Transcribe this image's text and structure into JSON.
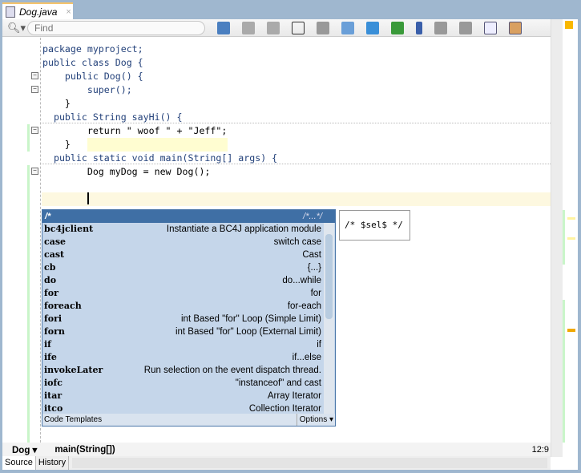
{
  "tab": {
    "title": "Dog.java",
    "close": "×"
  },
  "toolbar": {
    "find_placeholder": "Find"
  },
  "code": [
    "package myproject;",
    "",
    "public class Dog {",
    "    public Dog() {",
    "        super();",
    "    }",
    "  public String sayHi() {",
    "        return \" woof \" + \"Jeff\";",
    "    }",
    "  public static void main(String[] args) {",
    "        Dog myDog = new Dog();",
    ""
  ],
  "popup": {
    "header_left": "/*",
    "header_right": "/*...*/",
    "items": [
      {
        "abbr": "bc4jclient",
        "desc": "Instantiate a BC4J application module"
      },
      {
        "abbr": "case",
        "desc": "switch case"
      },
      {
        "abbr": "cast",
        "desc": "Cast"
      },
      {
        "abbr": "cb",
        "desc": "{...}"
      },
      {
        "abbr": "do",
        "desc": "do...while"
      },
      {
        "abbr": "for",
        "desc": "for"
      },
      {
        "abbr": "foreach",
        "desc": "for-each"
      },
      {
        "abbr": "fori",
        "desc": "int Based \"for\" Loop (Simple Limit)"
      },
      {
        "abbr": "forn",
        "desc": "int Based \"for\" Loop (External Limit)"
      },
      {
        "abbr": "if",
        "desc": "if"
      },
      {
        "abbr": "ife",
        "desc": "if...else"
      },
      {
        "abbr": "invokeLater",
        "desc": "Run selection on the event dispatch thread."
      },
      {
        "abbr": "iofc",
        "desc": "\"instanceof\"  and cast"
      },
      {
        "abbr": "itar",
        "desc": "Array Iterator"
      },
      {
        "abbr": "itco",
        "desc": "Collection Iterator"
      }
    ],
    "footer_left": "Code Templates",
    "footer_right": "Options ▾"
  },
  "preview": "/* $sel$ */",
  "breadcrumb": {
    "items": [
      "Dog ▾",
      "main(String[])"
    ],
    "position": "12:9"
  },
  "bottom_tabs": [
    "Source",
    "History"
  ],
  "colors": {
    "accent": "#3f6fa5",
    "popup_bg": "#c5d6ea",
    "highlight": "#fffbb3"
  }
}
